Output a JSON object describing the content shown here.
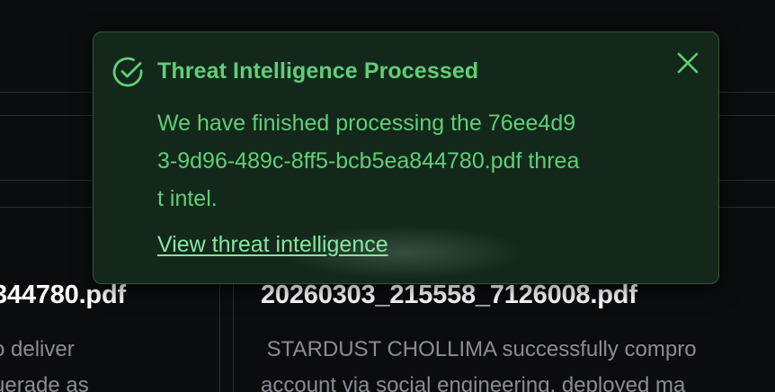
{
  "toast": {
    "title": "Threat Intelligence Processed",
    "message": "We have finished processing the 76ee4d93-9d96-489c-8ff5-bcb5ea844780.pdf threat intel.",
    "link_label": "View threat intelligence",
    "status_icon": "check-circle-icon",
    "close_icon": "close-icon",
    "accent_color": "#5fcf77",
    "link_color": "#86e6a2"
  },
  "cards": [
    {
      "file_name": "344780.pdf",
      "snippet_lines": [
        "o deliver",
        "uerade as"
      ]
    },
    {
      "file_name": "20260303_215558_7126008.pdf",
      "snippet_lines": [
        " STARDUST CHOLLIMA successfully compro",
        "account via social engineering, deployed ma"
      ]
    }
  ]
}
